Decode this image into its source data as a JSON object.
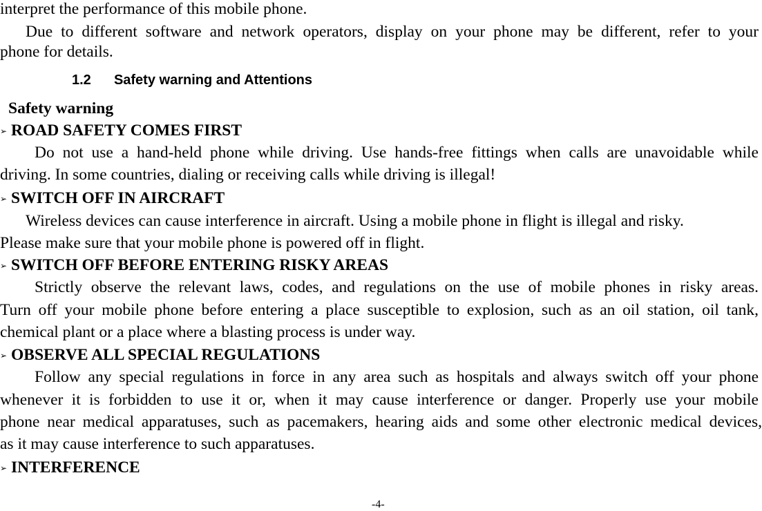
{
  "page": {
    "intro": {
      "line1": "interpret the performance of this mobile phone.",
      "para_line1": "Due to different software and network operators, display on your phone may be different, refer to your",
      "para_line2": "phone for details."
    },
    "section": {
      "number": "1.2",
      "title": "Safety warning and Attentions"
    },
    "subheading": "Safety warning",
    "bullet_icon": "arrowhead-right-icon",
    "items": [
      {
        "title": "ROAD SAFETY COMES FIRST",
        "lines": [
          "Do not use a hand-held phone while driving. Use hands-free fittings when calls are unavoidable while",
          "driving. In some countries, dialing or receiving calls while driving is illegal!"
        ]
      },
      {
        "title": "SWITCH OFF IN AIRCRAFT",
        "lines": [
          "Wireless devices can cause interference in aircraft. Using a mobile phone in flight is illegal and risky.",
          "Please make sure that your mobile phone is powered off in flight."
        ]
      },
      {
        "title": "SWITCH OFF BEFORE ENTERING RISKY AREAS",
        "lines": [
          "Strictly observe the relevant laws, codes, and regulations on the use of mobile phones in risky areas.",
          "Turn off your mobile phone before entering a place susceptible to explosion, such as an oil station, oil tank,",
          "chemical plant or a place where a blasting process is under way."
        ]
      },
      {
        "title": "OBSERVE ALL SPECIAL REGULATIONS",
        "lines": [
          "Follow any special regulations in force in any area such as hospitals and always switch off your phone",
          "whenever it is forbidden to use it or, when it may cause interference or danger. Properly use your mobile",
          "phone near medical apparatuses, such as pacemakers, hearing aids and some other electronic medical devices,",
          "as it may cause interference to such apparatuses."
        ]
      },
      {
        "title": "INTERFERENCE",
        "lines": []
      }
    ],
    "page_number": "-4-"
  }
}
